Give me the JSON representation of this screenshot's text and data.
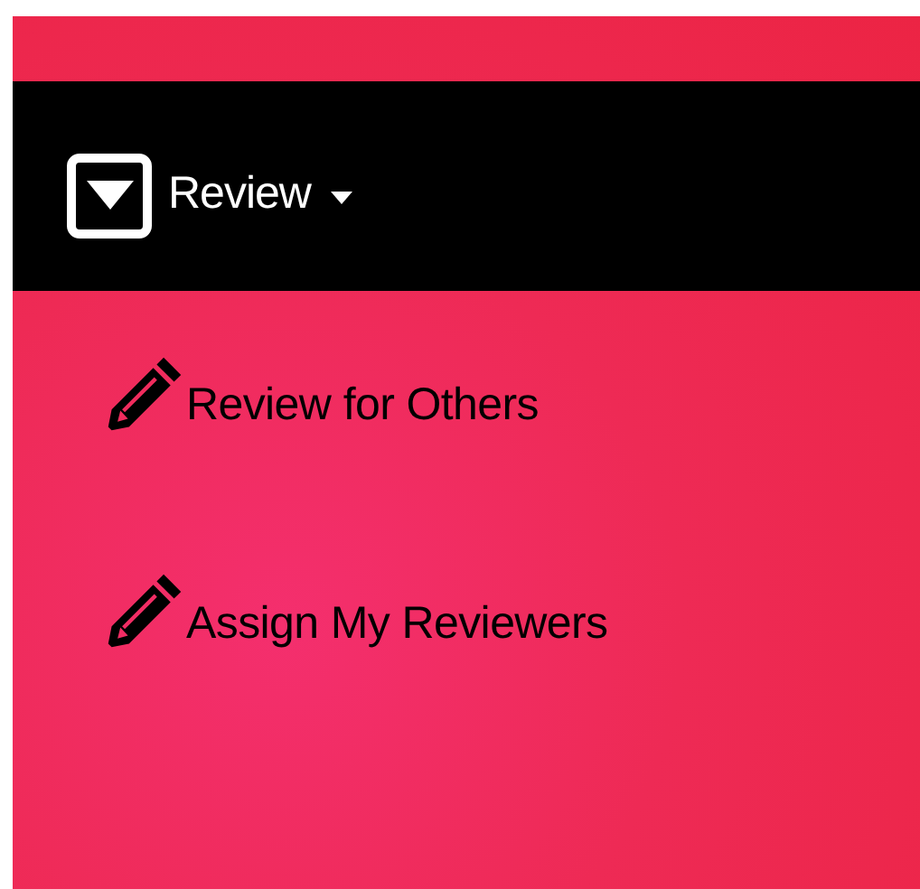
{
  "menu": {
    "label": "Review"
  },
  "items": [
    {
      "label": "Review for Others"
    },
    {
      "label": "Assign My Reviewers"
    }
  ]
}
